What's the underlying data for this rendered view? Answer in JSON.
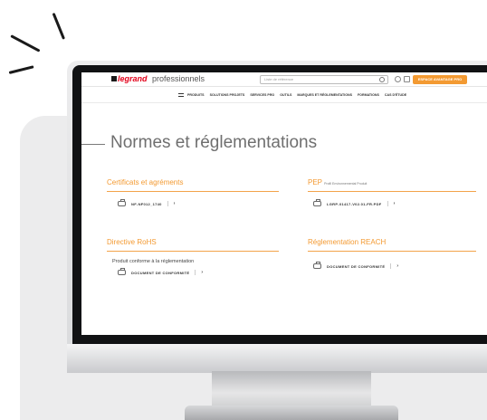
{
  "header": {
    "logo_brand": "legrand",
    "logo_sub": "professionnels",
    "search_placeholder": "Liste de référence",
    "cta_label": "ESPACE AVANTAGE PRO"
  },
  "nav": {
    "items": [
      "PRODUITS",
      "SOLUTIONS PROJETS",
      "SERVICES PRO",
      "OUTILS",
      "MARQUES ET RÉGLEMENTATIONS",
      "FORMATIONS",
      "CAS D'ÉTUDE"
    ]
  },
  "page": {
    "title": "Normes et réglementations"
  },
  "sections": {
    "certificats": {
      "title": "Certificats et agréments",
      "doc": "NF-NF012_1740"
    },
    "pep": {
      "title": "PEP",
      "subtitle": "Profil Environnemental Produit",
      "doc": "LGRP-01417-V02.01-FR.PDF"
    },
    "rohs": {
      "title": "Directive RoHS",
      "text": "Produit conforme à la réglementation",
      "doc": "DOCUMENT DE CONFORMITÉ"
    },
    "reach": {
      "title": "Réglementation REACH",
      "doc": "DOCUMENT DE CONFORMITÉ"
    }
  },
  "arrow": "›",
  "colors": {
    "accent": "#f39a32",
    "brand": "#e2001a"
  }
}
